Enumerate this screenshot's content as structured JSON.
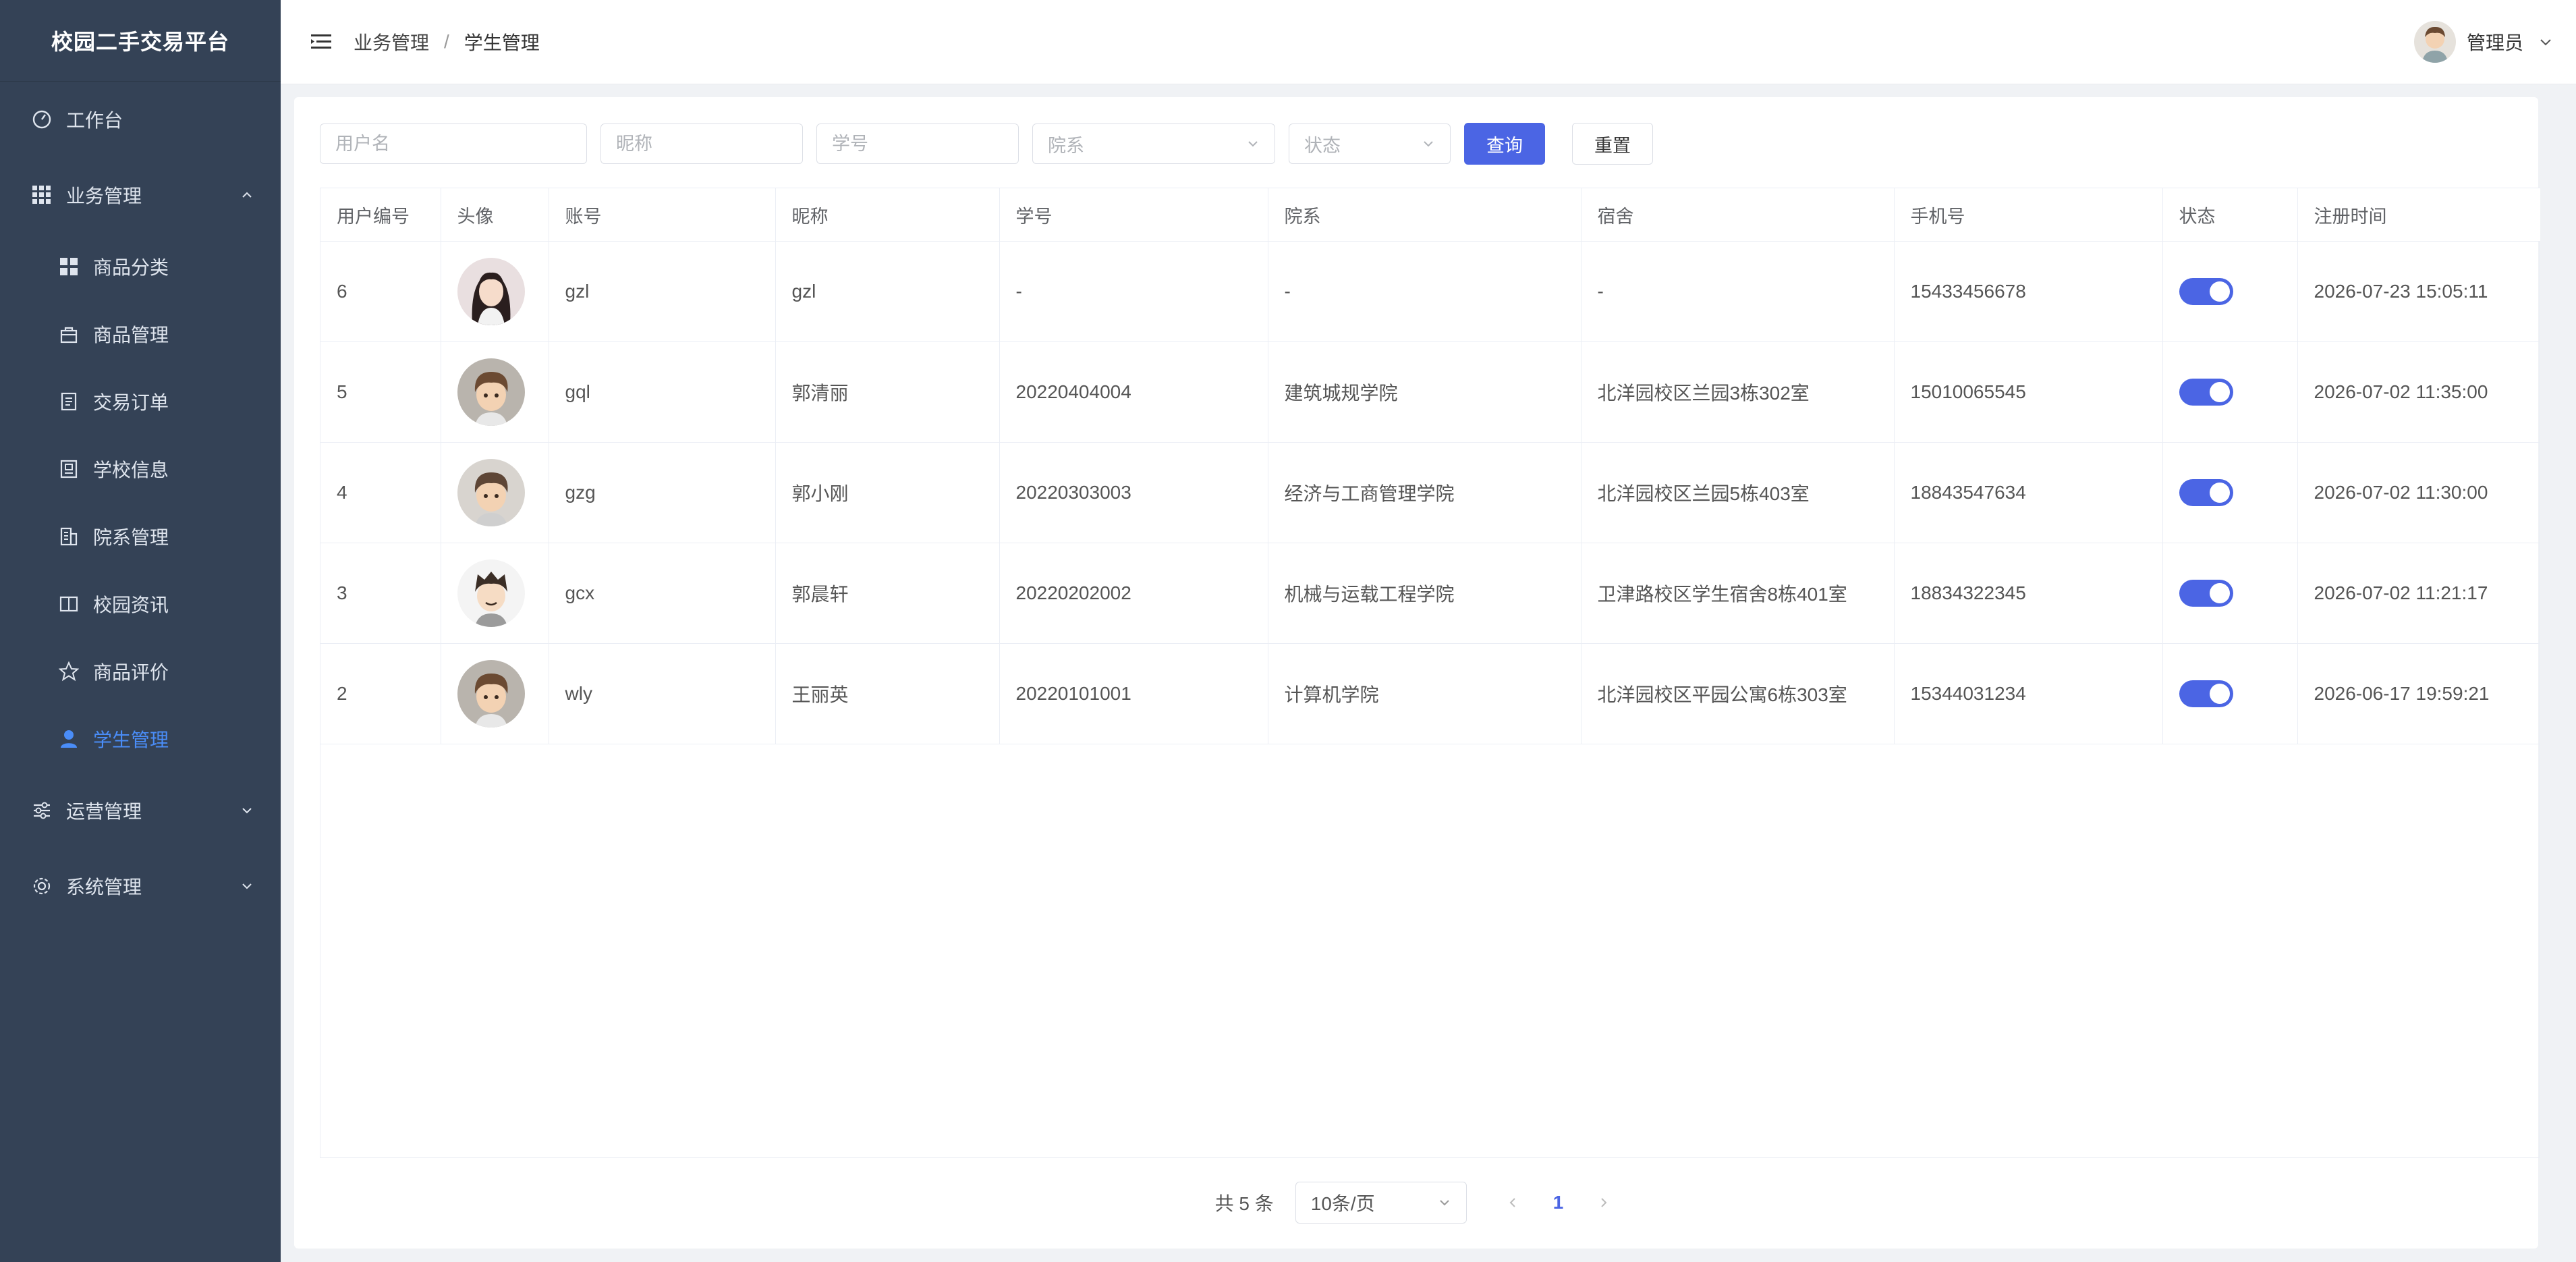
{
  "app": {
    "title": "校园二手交易平台"
  },
  "sidebar": {
    "items": [
      {
        "label": "工作台",
        "icon": "dashboard-icon"
      },
      {
        "label": "业务管理",
        "icon": "grid-icon",
        "expanded": true,
        "children": [
          {
            "label": "商品分类",
            "icon": "category-icon"
          },
          {
            "label": "商品管理",
            "icon": "bag-icon"
          },
          {
            "label": "交易订单",
            "icon": "order-icon"
          },
          {
            "label": "学校信息",
            "icon": "school-icon"
          },
          {
            "label": "院系管理",
            "icon": "building-icon"
          },
          {
            "label": "校园资讯",
            "icon": "book-icon"
          },
          {
            "label": "商品评价",
            "icon": "star-icon"
          },
          {
            "label": "学生管理",
            "icon": "user-icon",
            "active": true
          }
        ]
      },
      {
        "label": "运营管理",
        "icon": "sliders-icon"
      },
      {
        "label": "系统管理",
        "icon": "gear-icon"
      }
    ]
  },
  "header": {
    "breadcrumb": [
      "业务管理",
      "学生管理"
    ],
    "separator": "/",
    "user": "管理员"
  },
  "filters": {
    "username_placeholder": "用户名",
    "nickname_placeholder": "昵称",
    "student_no_placeholder": "学号",
    "department_placeholder": "院系",
    "status_placeholder": "状态",
    "search_label": "查询",
    "reset_label": "重置"
  },
  "table": {
    "columns": [
      "用户编号",
      "头像",
      "账号",
      "昵称",
      "学号",
      "院系",
      "宿舍",
      "手机号",
      "状态",
      "注册时间"
    ],
    "rows": [
      {
        "id": "6",
        "account": "gzl",
        "nickname": "gzl",
        "student_no": "-",
        "department": "-",
        "dorm": "-",
        "phone": "15433456678",
        "status_on": true,
        "registered": "2026-07-23 15:05:11"
      },
      {
        "id": "5",
        "account": "gql",
        "nickname": "郭清丽",
        "student_no": "20220404004",
        "department": "建筑城规学院",
        "dorm": "北洋园校区兰园3栋302室",
        "phone": "15010065545",
        "status_on": true,
        "registered": "2026-07-02 11:35:00"
      },
      {
        "id": "4",
        "account": "gzg",
        "nickname": "郭小刚",
        "student_no": "20220303003",
        "department": "经济与工商管理学院",
        "dorm": "北洋园校区兰园5栋403室",
        "phone": "18843547634",
        "status_on": true,
        "registered": "2026-07-02 11:30:00"
      },
      {
        "id": "3",
        "account": "gcx",
        "nickname": "郭晨轩",
        "student_no": "20220202002",
        "department": "机械与运载工程学院",
        "dorm": "卫津路校区学生宿舍8栋401室",
        "phone": "18834322345",
        "status_on": true,
        "registered": "2026-07-02 11:21:17"
      },
      {
        "id": "2",
        "account": "wly",
        "nickname": "王丽英",
        "student_no": "20220101001",
        "department": "计算机学院",
        "dorm": "北洋园校区平园公寓6栋303室",
        "phone": "15344031234",
        "status_on": true,
        "registered": "2026-06-17 19:59:21"
      }
    ]
  },
  "pagination": {
    "total": "共 5 条",
    "page_size": "10条/页",
    "current_page": "1"
  },
  "colors": {
    "sidebar_bg": "#344256",
    "primary": "#4b65e4",
    "active_menu": "#4a8df8"
  }
}
